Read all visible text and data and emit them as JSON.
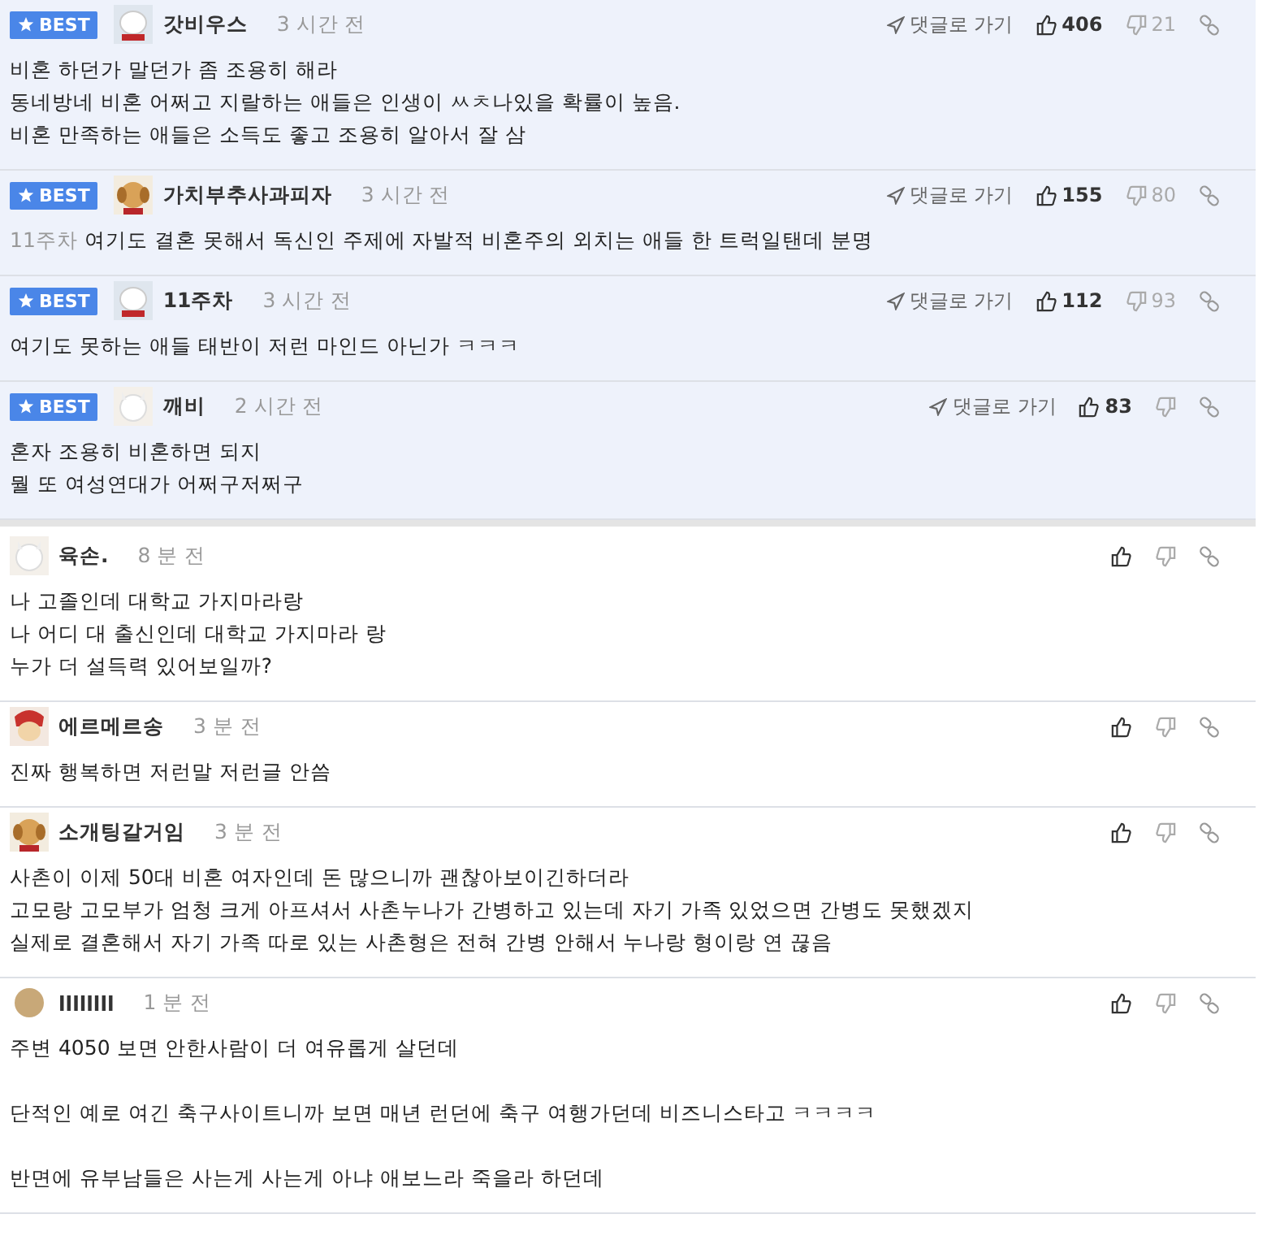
{
  "comments": [
    {
      "best": true,
      "badge": "BEST",
      "author": "갓비우스",
      "time": "3 시간 전",
      "go_reply": "댓글로 가기",
      "likes": "406",
      "dislikes": "21",
      "paragraphs": [
        [
          "비혼 하던가 말던가 좀 조용히 해라",
          "동네방네 비혼 어쩌고 지랄하는 애들은 인생이 ㅆㅊ나있을 확률이 높음.",
          "비혼 만족하는 애들은 소득도 좋고 조용히 알아서 잘 삼"
        ]
      ]
    },
    {
      "best": true,
      "badge": "BEST",
      "author": "가치부추사과피자",
      "time": "3 시간 전",
      "go_reply": "댓글로 가기",
      "likes": "155",
      "dislikes": "80",
      "mention": "11주차",
      "paragraphs": [
        [
          "여기도 결혼 못해서 독신인 주제에 자발적 비혼주의 외치는 애들 한 트럭일탠데 분명"
        ]
      ]
    },
    {
      "best": true,
      "badge": "BEST",
      "author": "11주차",
      "time": "3 시간 전",
      "go_reply": "댓글로 가기",
      "likes": "112",
      "dislikes": "93",
      "paragraphs": [
        [
          "여기도 못하는 애들 태반이 저런 마인드 아닌가 ㅋㅋㅋ"
        ]
      ]
    },
    {
      "best": true,
      "badge": "BEST",
      "author": "깨비",
      "time": "2 시간 전",
      "go_reply": "댓글로 가기",
      "likes": "83",
      "paragraphs": [
        [
          "혼자 조용히 비혼하면 되지",
          "뭘 또 여성연대가 어쩌구저쩌구"
        ]
      ]
    },
    {
      "best": false,
      "author": "육손.",
      "time": "8 분 전",
      "paragraphs": [
        [
          "나 고졸인데 대학교 가지마라랑",
          "나 어디 대 출신인데 대학교 가지마라 랑",
          "누가 더 설득력 있어보일까?"
        ]
      ]
    },
    {
      "best": false,
      "author": "에르메르송",
      "time": "3 분 전",
      "paragraphs": [
        [
          "진짜 행복하면 저런말 저런글 안씀"
        ]
      ]
    },
    {
      "best": false,
      "author": "소개팅갈거임",
      "time": "3 분 전",
      "paragraphs": [
        [
          "사촌이 이제 50대 비혼 여자인데 돈 많으니까 괜찮아보이긴하더라",
          "고모랑 고모부가 엄청 크게 아프셔서 사촌누나가 간병하고 있는데 자기 가족 있었으면 간병도 못했겠지",
          "실제로 결혼해서 자기 가족 따로 있는 사촌형은 전혀 간병 안해서 누나랑 형이랑 연 끊음"
        ]
      ]
    },
    {
      "best": false,
      "author": "llllllll",
      "time": "1 분 전",
      "paragraphs": [
        [
          "주변 4050 보면 안한사람이 더 여유롭게 살던데"
        ],
        [
          "단적인 예로 여긴 축구사이트니까 보면 매년 런던에 축구 여행가던데 비즈니스타고 ㅋㅋㅋㅋ"
        ],
        [
          "반면에 유부남들은 사는게 사는게 아냐 애보느라 죽을라 하던데"
        ]
      ]
    }
  ]
}
